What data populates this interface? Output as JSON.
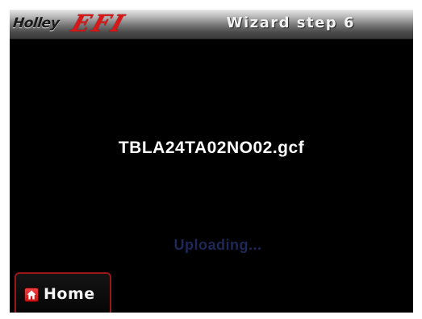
{
  "header": {
    "logo_text": "Holley EFI",
    "logo_brand": "Holley",
    "logo_mark": "EFI",
    "title": "Wizard step 6"
  },
  "main": {
    "filename": "TBLA24TA02NO02.gcf",
    "status": "Uploading..."
  },
  "footer": {
    "home_label": "Home",
    "home_icon": "home-icon"
  },
  "colors": {
    "background": "#000000",
    "title_text": "#f2f2f2",
    "status_text": "#1e2858",
    "accent_red": "#d81818",
    "button_border": "#9a1818"
  }
}
